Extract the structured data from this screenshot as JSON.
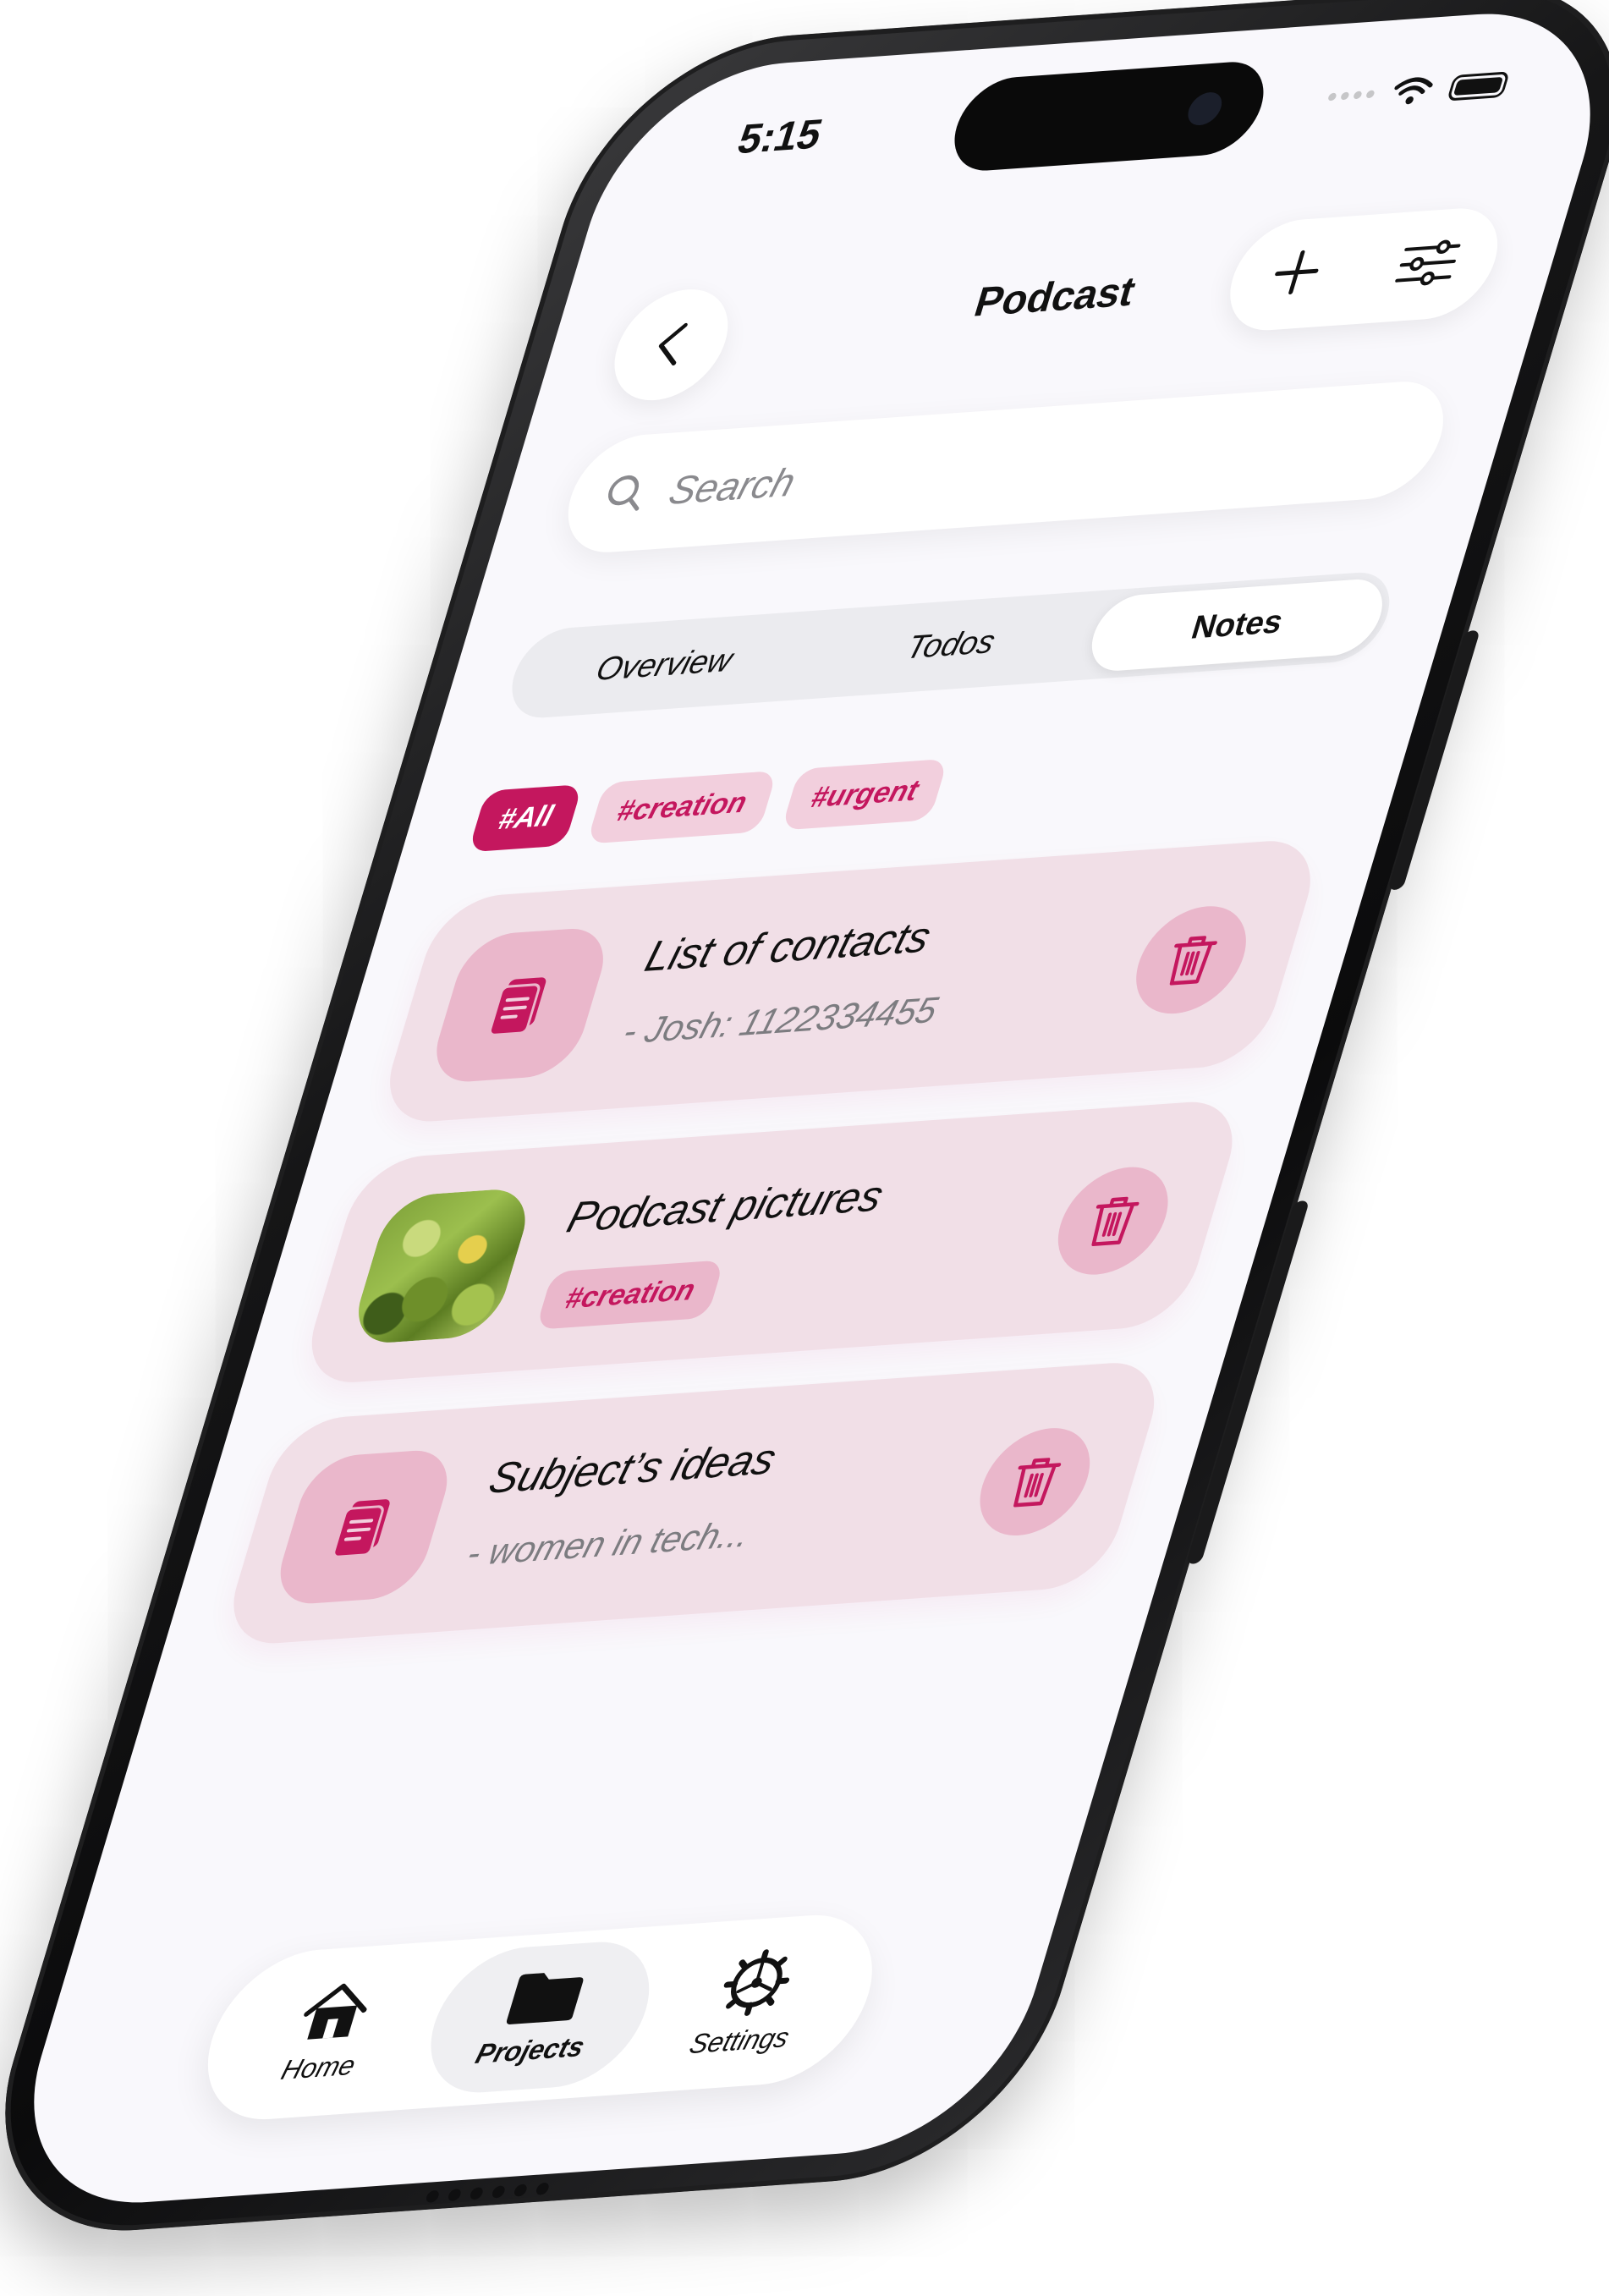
{
  "status_bar": {
    "time": "5:15"
  },
  "header": {
    "title": "Podcast",
    "back_icon": "chevron-left-icon",
    "add_icon": "plus-icon",
    "filter_icon": "sliders-icon"
  },
  "search": {
    "placeholder": "Search",
    "icon": "search-icon"
  },
  "segments": {
    "items": [
      {
        "label": "Overview",
        "active": false
      },
      {
        "label": "Todos",
        "active": false
      },
      {
        "label": "Notes",
        "active": true
      }
    ]
  },
  "tags": {
    "items": [
      {
        "label": "#All",
        "active": true
      },
      {
        "label": "#creation",
        "active": false
      },
      {
        "label": "#urgent",
        "active": false
      }
    ]
  },
  "notes": {
    "items": [
      {
        "title": "List of contacts",
        "subtitle": "- Josh: 1122334455",
        "thumb": "note-icon"
      },
      {
        "title": "Podcast pictures",
        "tag": "#creation",
        "thumb": "photo"
      },
      {
        "title": "Subject’s ideas",
        "subtitle": "- women in tech...",
        "thumb": "note-icon"
      }
    ]
  },
  "tabbar": {
    "items": [
      {
        "label": "Home",
        "icon": "home-icon",
        "active": false
      },
      {
        "label": "Projects",
        "icon": "folder-icon",
        "active": true
      },
      {
        "label": "Settings",
        "icon": "gear-icon",
        "active": false
      }
    ]
  },
  "colors": {
    "accent": "#c4175e",
    "tag_bg": "#f2cfdd",
    "card_bg": "#f1dfe7",
    "screen_bg": "#f9f8fc"
  }
}
